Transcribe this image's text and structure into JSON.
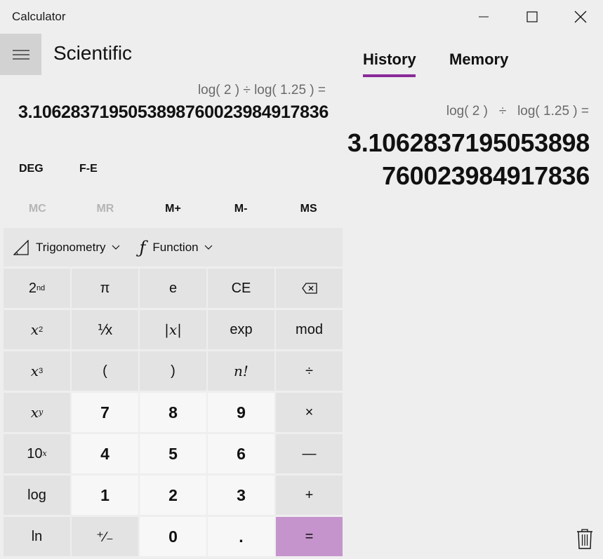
{
  "window": {
    "title": "Calculator"
  },
  "header": {
    "mode": "Scientific"
  },
  "display": {
    "expression": "log( 2 ) ÷ log( 1.25 ) =",
    "result": "3.1062837195053898760023984917836"
  },
  "settings": {
    "angle_mode": "DEG",
    "notation": "F-E"
  },
  "memory_buttons": [
    {
      "label": "MC",
      "enabled": false
    },
    {
      "label": "MR",
      "enabled": false
    },
    {
      "label": "M+",
      "enabled": true
    },
    {
      "label": "M-",
      "enabled": true
    },
    {
      "label": "MS",
      "enabled": true
    }
  ],
  "function_bar": {
    "trigonometry_label": "Trigonometry",
    "function_label": "Function"
  },
  "keypad": {
    "second": "2",
    "second_sup": "nd",
    "pi": "π",
    "e": "e",
    "ce": "CE",
    "x": "x",
    "two": "2",
    "reciprocal": "⅟x",
    "abs": "|x|",
    "exp": "exp",
    "mod": "mod",
    "three": "3",
    "open_paren": "(",
    "close_paren": ")",
    "factorial": "n!",
    "divide": "÷",
    "y": "y",
    "digit_7": "7",
    "digit_8": "8",
    "digit_9": "9",
    "multiply": "×",
    "ten": "10",
    "digit_4": "4",
    "digit_5": "5",
    "digit_6": "6",
    "minus": "—",
    "log": "log",
    "digit_1": "1",
    "digit_2": "2",
    "digit_3": "3",
    "plus": "+",
    "ln": "ln",
    "negate": "⁺∕₋",
    "digit_0": "0",
    "decimal": ".",
    "equals": "="
  },
  "panel": {
    "tabs": [
      "History",
      "Memory"
    ],
    "active_tab": "History",
    "history_entry": {
      "expression": "log( 2 )   ÷   log( 1.25 ) =",
      "result_line1": "3.1062837195053898",
      "result_line2": "760023984917836"
    }
  },
  "colors": {
    "background": "#eeeeee",
    "accent": "#8a2a9a",
    "equals_key": "#c594cc"
  }
}
